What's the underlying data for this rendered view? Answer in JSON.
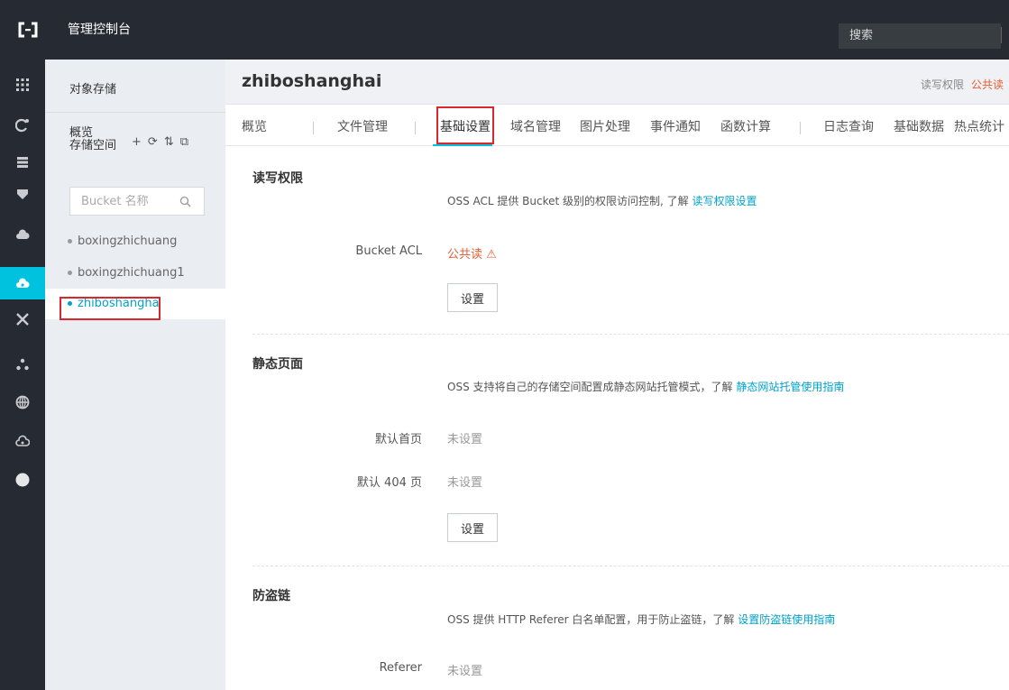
{
  "topbar": {
    "title": "管理控制台",
    "search_label": "搜索"
  },
  "rail": {
    "icons": [
      "grid-icon",
      "cdn-icon",
      "server-icon",
      "shield-icon",
      "cloud-icon",
      "oss-icon",
      "network-icon",
      "cluster-icon",
      "globe-icon",
      "cloud-settings-icon",
      "circle-icon"
    ],
    "active_index": 5
  },
  "sidebar": {
    "title": "对象存储",
    "overview": "概览",
    "storage_label": "存储空间",
    "tools": [
      "+",
      "⟳",
      "⇅",
      "⧉"
    ],
    "search_placeholder": "Bucket 名称",
    "buckets": [
      "boxingzhichuang",
      "boxingzhichuang1",
      "zhiboshangha"
    ]
  },
  "main": {
    "bucket_name": "zhiboshanghai",
    "acl_label": "读写权限",
    "acl_value": "公共读",
    "tabs": [
      "概览",
      "文件管理",
      "基础设置",
      "域名管理",
      "图片处理",
      "事件通知",
      "函数计算",
      "日志查询",
      "基础数据",
      "热点统计"
    ],
    "active_tab": "基础设置",
    "sections": {
      "acl": {
        "title": "读写权限",
        "desc": "OSS ACL 提供 Bucket 级别的权限访问控制, 了解 ",
        "desc_link": "读写权限设置",
        "field_label": "Bucket ACL",
        "field_value": "公共读 ⚠",
        "button": "设置"
      },
      "static": {
        "title": "静态页面",
        "desc": "OSS 支持将自己的存储空间配置成静态网站托管模式，了解 ",
        "desc_link": "静态网站托管使用指南",
        "index_label": "默认首页",
        "index_value": "未设置",
        "notfound_label": "默认 404 页",
        "notfound_value": "未设置",
        "button": "设置"
      },
      "referer": {
        "title": "防盗链",
        "desc": "OSS 提供 HTTP Referer 白名单配置，用于防止盗链，了解 ",
        "desc_link": "设置防盗链使用指南",
        "field_label": "Referer",
        "field_value": "未设置"
      }
    }
  },
  "colors": {
    "accent": "#00c1de",
    "topbar": "#262b33",
    "warning": "#e45d35",
    "highlight_box": "#d9272e"
  }
}
